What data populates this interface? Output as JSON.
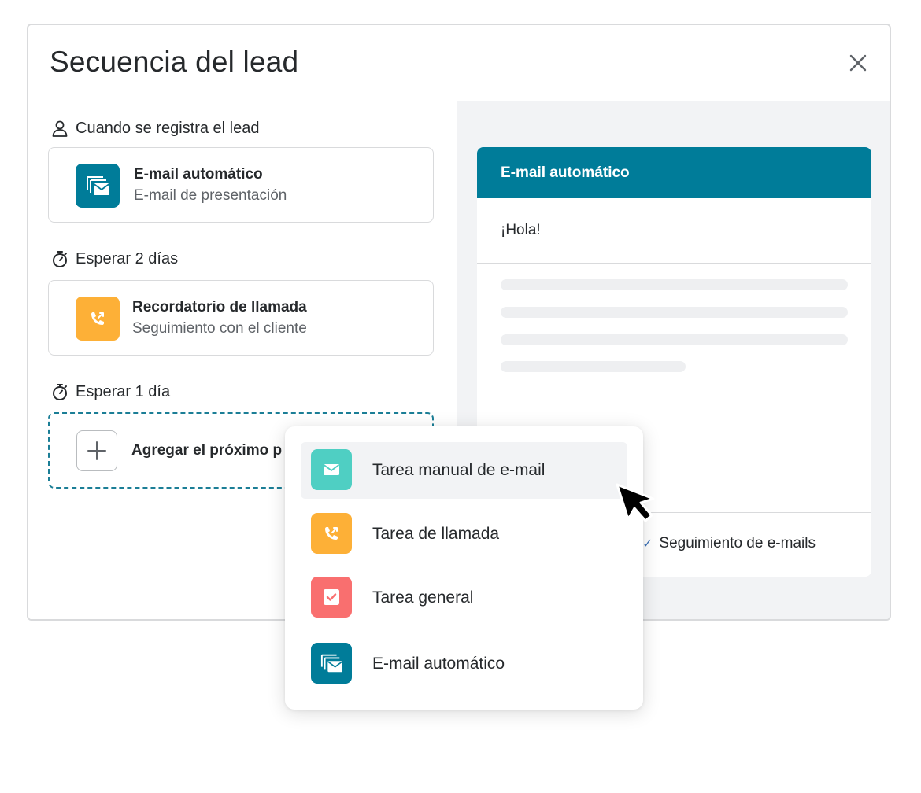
{
  "modal": {
    "title": "Secuencia del lead"
  },
  "sequence": {
    "trigger_label": "Cuando se registra el lead",
    "steps": [
      {
        "title": "E-mail automático",
        "subtitle": "E-mail de presentación",
        "icon": "email-stack-icon",
        "color": "#007c99"
      },
      {
        "wait_label": "Esperar 2 días",
        "title": "Recordatorio de llamada",
        "subtitle": "Seguimiento con el cliente",
        "icon": "phone-call-icon",
        "color": "#fdb037"
      }
    ],
    "next_wait_label": "Esperar 1 día",
    "add_step_label": "Agregar el próximo p"
  },
  "preview": {
    "header": "E-mail automático",
    "greeting": "¡Hola!",
    "tracking_label": "Seguimiento de e-mails",
    "tracking_checked": true,
    "header_color": "#007c99"
  },
  "dropdown": {
    "items": [
      {
        "label": "Tarea manual de e-mail",
        "icon": "envelope-icon",
        "color": "#4fcfc3",
        "active": true
      },
      {
        "label": "Tarea de llamada",
        "icon": "phone-call-icon",
        "color": "#fdb037",
        "active": false
      },
      {
        "label": "Tarea general",
        "icon": "checkbox-icon",
        "color": "#f96f6f",
        "active": false
      },
      {
        "label": "E-mail automático",
        "icon": "email-stack-icon",
        "color": "#007c99",
        "active": false
      }
    ]
  }
}
